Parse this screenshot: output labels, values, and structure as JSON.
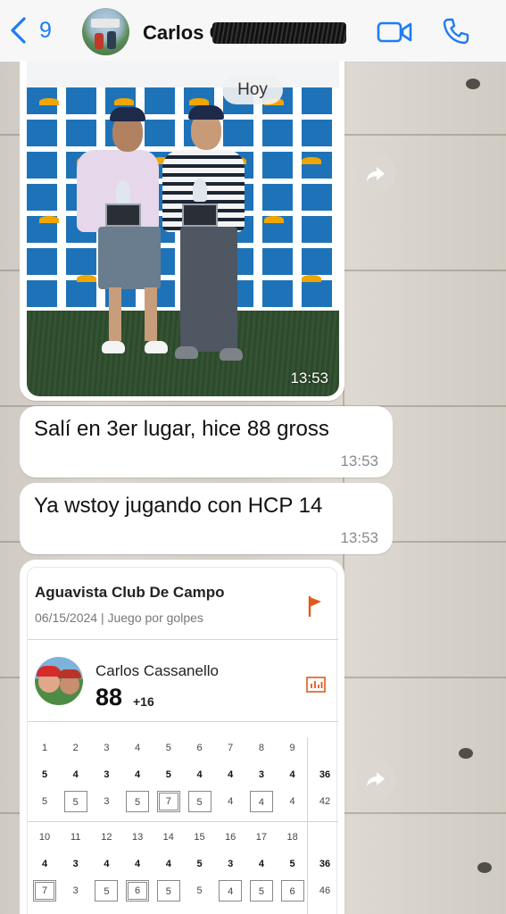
{
  "header": {
    "back_count": "9",
    "contact_name": "Carlos Co",
    "video_icon": "video-camera-icon",
    "phone_icon": "phone-icon",
    "accent": "#1f7cf4"
  },
  "chat": {
    "date_chip": "Hoy",
    "photo_time": "13:53",
    "messages": [
      {
        "text": "Salí en 3er lugar, hice 88 gross",
        "time": "13:53"
      },
      {
        "text": "Ya wstoy jugando con HCP 14",
        "time": "13:53"
      }
    ]
  },
  "scorecard": {
    "club": "Aguavista Club De Campo",
    "subtitle": "06/15/2024 | Juego por golpes",
    "player": "Carlos Cassanello",
    "gross": "88",
    "over_par": "+16",
    "front": {
      "holes": [
        "1",
        "2",
        "3",
        "4",
        "5",
        "6",
        "7",
        "8",
        "9"
      ],
      "par": [
        "5",
        "4",
        "3",
        "4",
        "5",
        "4",
        "4",
        "3",
        "4"
      ],
      "score": [
        "5",
        "5",
        "3",
        "5",
        "7",
        "5",
        "4",
        "4",
        "4"
      ],
      "marks": [
        "",
        "box",
        "",
        "box",
        "dbox",
        "box",
        "",
        "box",
        ""
      ],
      "par_total": "36",
      "score_total": "42"
    },
    "back": {
      "holes": [
        "10",
        "11",
        "12",
        "13",
        "14",
        "15",
        "16",
        "17",
        "18"
      ],
      "par": [
        "4",
        "3",
        "4",
        "4",
        "4",
        "5",
        "3",
        "4",
        "5"
      ],
      "score": [
        "7",
        "3",
        "5",
        "6",
        "5",
        "5",
        "4",
        "5",
        "6"
      ],
      "marks": [
        "dbox",
        "",
        "box",
        "dbox",
        "box",
        "",
        "box",
        "box",
        "box"
      ],
      "par_total": "36",
      "score_total": "46"
    }
  }
}
